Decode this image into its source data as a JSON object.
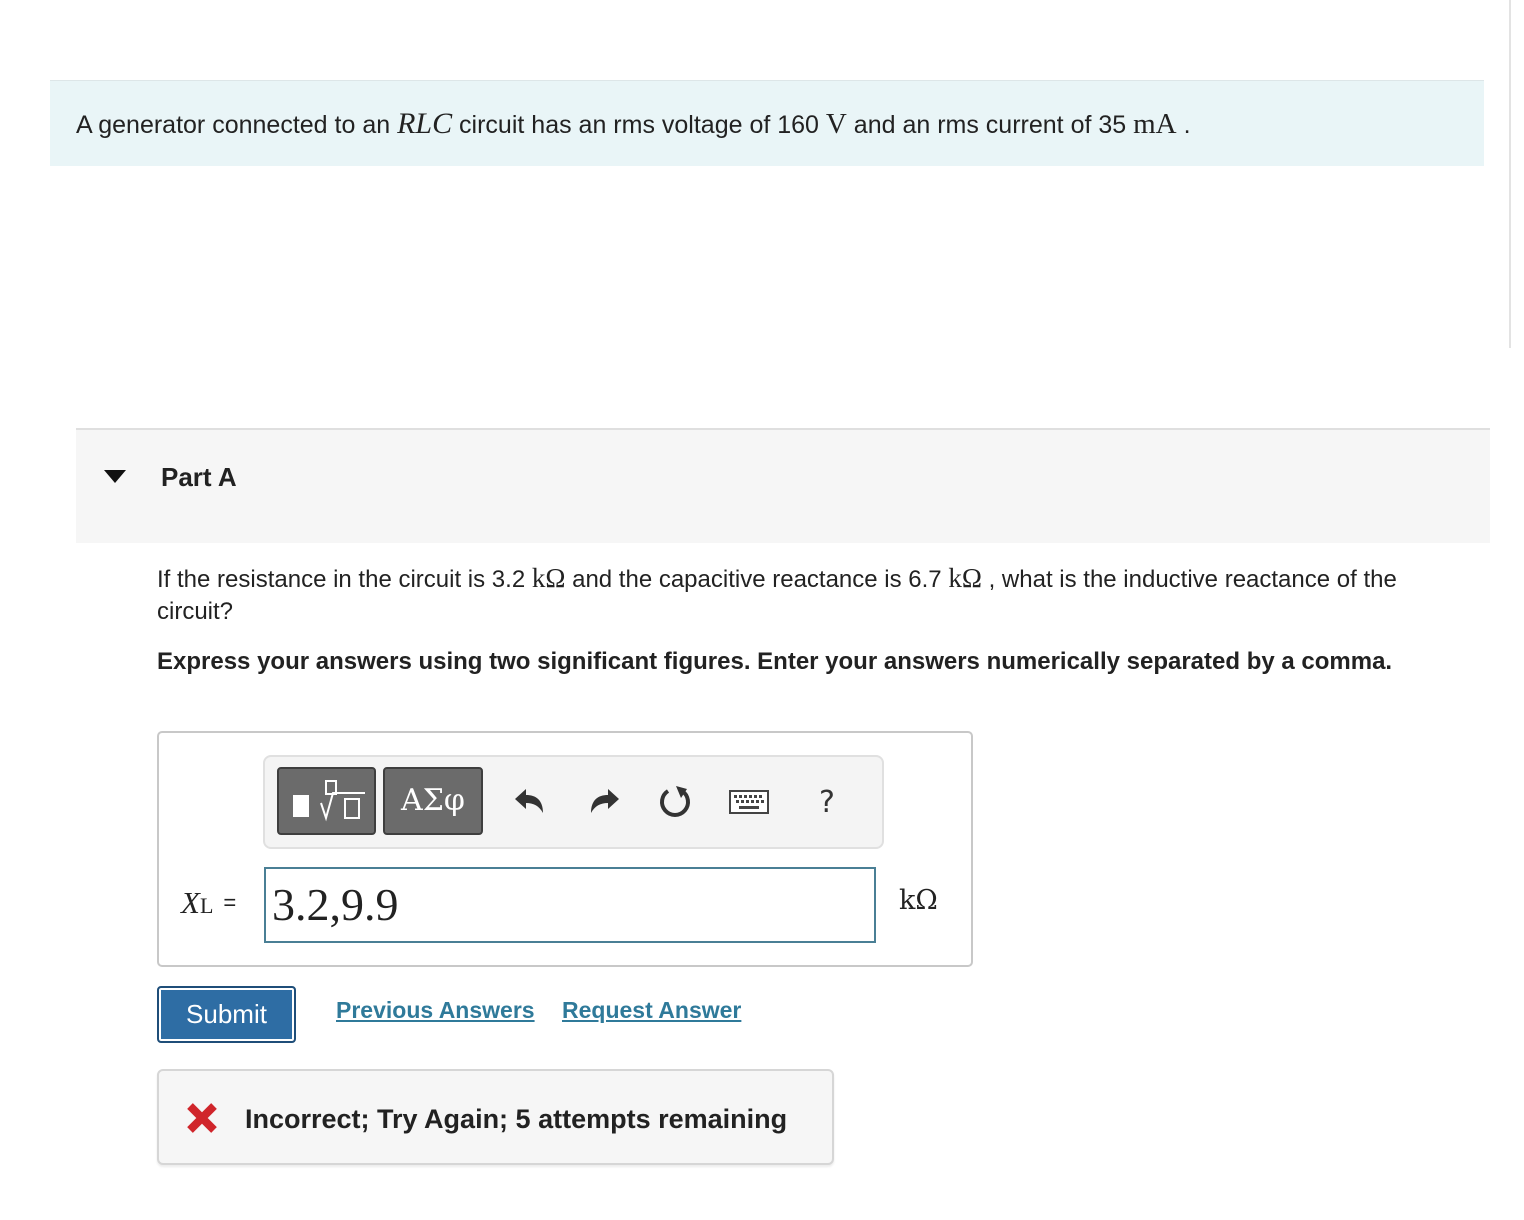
{
  "intro": {
    "t1": "A generator connected to an ",
    "rlc": "RLC",
    "t2": " circuit has an rms voltage of 160 ",
    "volt_unit": "V",
    "t3": " and an rms current of 35 ",
    "current_unit": "mA",
    "t4": " ."
  },
  "part": {
    "title": "Part A"
  },
  "question": {
    "t1": "If the resistance in the circuit is 3.2 ",
    "u1": "kΩ",
    "t2": " and the capacitive reactance is 6.7 ",
    "u2": "kΩ",
    "t3": " , what is the inductive reactance of the circuit?"
  },
  "instructions": "Express your answers using two significant figures. Enter your answers numerically separated by a comma.",
  "toolbar": {
    "greek_label": "ΑΣφ",
    "help_label": "?"
  },
  "answer": {
    "var": "X",
    "sub": "L",
    "eq": "=",
    "value": "3.2,9.9",
    "unit": "kΩ"
  },
  "actions": {
    "submit": "Submit",
    "previous": "Previous Answers",
    "request": "Request Answer"
  },
  "feedback": {
    "text": "Incorrect; Try Again; 5 attempts remaining",
    "color": "#d0252b"
  }
}
